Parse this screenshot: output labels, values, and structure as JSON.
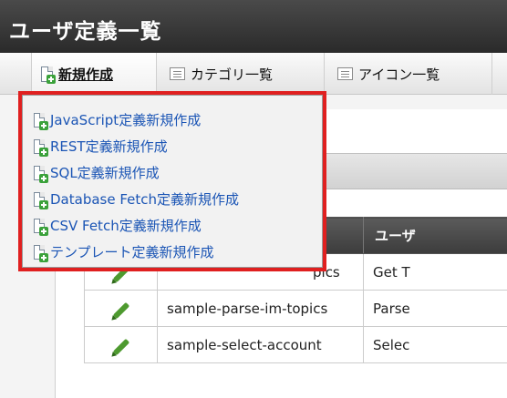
{
  "header": {
    "title": "ユーザ定義一覧"
  },
  "toolbar": {
    "new_label": "新規作成",
    "category_label": "カテゴリ一覧",
    "icon_label": "アイコン一覧"
  },
  "menu": {
    "items": [
      {
        "label": "JavaScript定義新規作成"
      },
      {
        "label": "REST定義新規作成"
      },
      {
        "label": "SQL定義新規作成"
      },
      {
        "label": "Database Fetch定義新規作成"
      },
      {
        "label": "CSV Fetch定義新規作成"
      },
      {
        "label": "テンプレート定義新規作成"
      }
    ]
  },
  "table": {
    "header_col3": "ユーザ",
    "rows": [
      {
        "name": "pics",
        "desc": "Get T"
      },
      {
        "name": "sample-parse-im-topics",
        "desc": "Parse"
      },
      {
        "name": "sample-select-account",
        "desc": "Selec"
      }
    ]
  },
  "colors": {
    "highlight": "#e02020",
    "link": "#1b55b5",
    "header_bg": "#333333"
  },
  "icons": {
    "new": "new-document-icon",
    "list": "list-icon",
    "edit": "pencil-icon"
  }
}
